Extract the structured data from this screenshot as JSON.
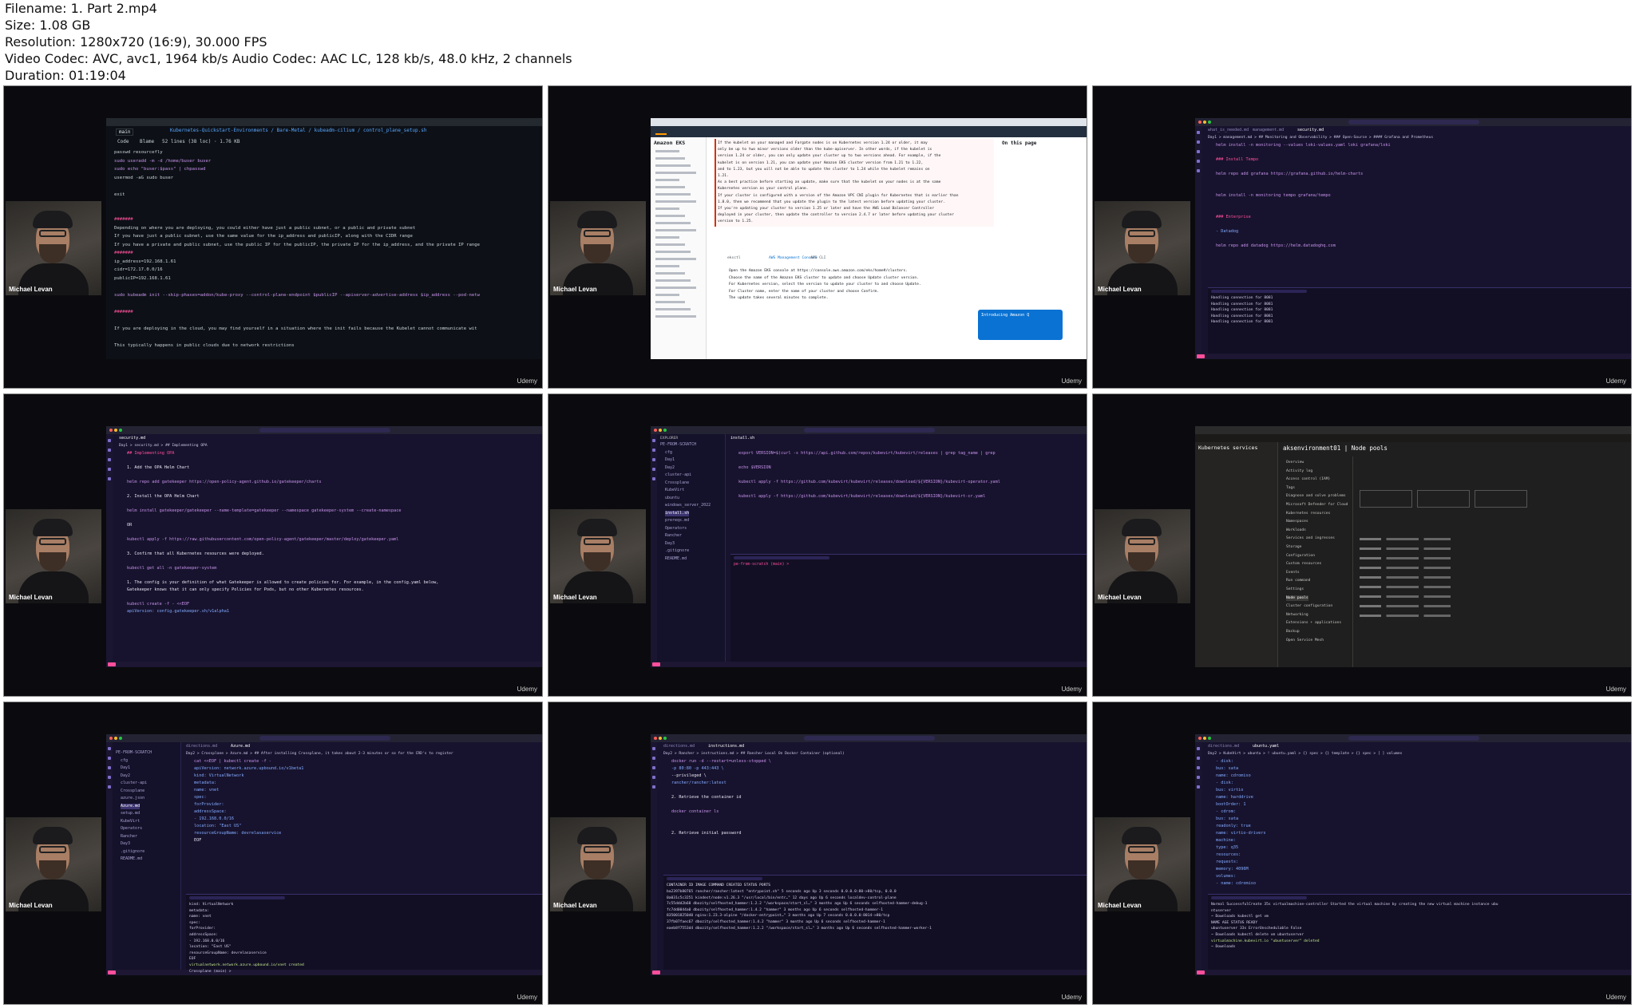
{
  "file_info": {
    "filename": "Filename: 1. Part 2.mp4",
    "size": "Size: 1.08 GB",
    "resolution": "Resolution: 1280x720 (16:9), 30.000 FPS",
    "codecs": "Video Codec: AVC, avc1, 1964 kb/s Audio Codec: AAC LC, 128 kb/s, 48.0 kHz, 2 channels",
    "duration": "Duration: 01:19:04"
  },
  "presenter": "Michael Levan",
  "watermark": "Udemy",
  "thumbnails": [
    {
      "id": "t1",
      "topic": "github-code-view",
      "breadcrumb": "Kubernetes-Quickstart-Environments / Bare-Metal / kubeadm-cilium / control_plane_setup.sh",
      "branch": "main",
      "tabs": [
        "Code",
        "Blame",
        "52 lines (38 loc) · 1.76 KB"
      ],
      "lines": [
        "  passwd resourcefly",
        "  sudo useradd -m -d /home/buser buser",
        "  sudo echo \"buser:$pass\" | chpasswd",
        "  usermod -aG sudo buser",
        "",
        "  exit",
        "",
        "",
        "  #######",
        "  Depending on where you are deploying, you could either have just a public subnet, or a public and private subnet",
        "  If you have just a public subnet, use the same value for the ip_address and publicIP, along with the CIDR range",
        "  If you have a private and public subnet, use the public IP for the publicIP, the private IP for the ip_address, and the private IP range",
        "  #######",
        "  ip_address=192.168.1.61",
        "  cidr=172.17.0.0/16",
        "  publicIP=192.168.1.61",
        "",
        "  sudo kubeadm init --skip-phases=addon/kube-proxy --control-plane-endpoint $publicIP --apiserver-advertise-address $ip_address --pod-netw",
        "",
        "  #######",
        "",
        "  If you are deploying in the cloud, you may find yourself in a situation where the init fails because the Kubelet cannot communicate wit",
        "",
        "  This typically happens in public clouds due to network restrictions"
      ]
    },
    {
      "id": "t2",
      "topic": "aws-eks-docs",
      "nav_title": "Amazon EKS",
      "right_title": "On this page",
      "lines": [
        "If the kubelet on your managed and Fargate nodes is on Kubernetes version 1.24 or older, it may",
        "only be up to two minor versions older than the kube-apiserver. In other words, if the kubelet is",
        "version 1.24 or older, you can only update your cluster up to two versions ahead. For example, if the",
        "kubelet is on version 1.21, you can update your Amazon EKS cluster version from 1.21 to 1.22,",
        "and to 1.23, but you will not be able to update the cluster to 1.24 while the kubelet remains on",
        "1.21.",
        "As a best practice before starting an update, make sure that the kubelet on your nodes is at the same",
        "Kubernetes version as your control plane.",
        "If your cluster is configured with a version of the Amazon VPC CNI plugin for Kubernetes that is earlier than",
        "1.8.0, then we recommend that you update the plugin to the latest version before updating your cluster.",
        "If you're updating your cluster to version 1.25 or later and have the AWS Load Balancer Controller",
        "deployed in your cluster, then update the controller to version 2.4.7 or later before updating your cluster",
        "version to 1.25."
      ],
      "tabs": [
        "eksctl",
        "AWS Management Console",
        "AWS CLI"
      ],
      "steps": [
        "Open the Amazon EKS console at https://console.aws.amazon.com/eks/home#/clusters.",
        "Choose the name of the Amazon EKS cluster to update and choose Update cluster version.",
        "For Kubernetes version, select the version to update your cluster to and choose Update.",
        "For Cluster name, enter the name of your cluster and choose Confirm.",
        "The update takes several minutes to complete."
      ],
      "popup_title": "Introducing Amazon Q"
    },
    {
      "id": "t3",
      "topic": "monitoring-md",
      "tabs": [
        "what_is_needed.md",
        "management.md",
        "security.md"
      ],
      "breadcrumb": "Day1 > management.md > ## Monitoring and Observability > ### Open-Source > #### Grafana and Prometheus",
      "lines": [
        "helm install -n monitoring --values loki-values.yaml loki grafana/loki",
        "",
        "### Install Tempo",
        "",
        "helm repo add grafana https://grafana.github.io/helm-charts",
        "",
        "",
        "helm install -n monitoring tempo grafana/tempo",
        "",
        "",
        "### Enterprise",
        "",
        "- Datadog",
        "",
        "helm repo add datadog https://helm.datadoghq.com"
      ],
      "terminal": [
        "Handling connection for 8081",
        "Handling connection for 8081",
        "Handling connection for 8081",
        "Handling connection for 8081",
        "Handling connection for 8081"
      ]
    },
    {
      "id": "t4",
      "topic": "security-md-opa",
      "tab": "security.md",
      "breadcrumb": "Day1 > security.md > ## Implementing OPA",
      "lines": [
        "## Implementing OPA",
        "",
        "1. Add the OPA Helm Chart",
        "",
        "helm repo add gatekeeper https://open-policy-agent.github.io/gatekeeper/charts",
        "",
        "2. Install the OPA Helm Chart",
        "",
        "helm install gatekeeper/gatekeeper --name-template=gatekeeper --namespace gatekeeper-system --create-namespace",
        "",
        "OR",
        "",
        "kubectl apply -f https://raw.githubusercontent.com/open-policy-agent/gatekeeper/master/deploy/gatekeeper.yaml",
        "",
        "3. Confirm that all Kubernetes resources were deployed.",
        "",
        "kubectl get all -n gatekeeper-system",
        "",
        "1. The config is your definition of what Gatekeeper is allowed to create policies for. For example, in the config.yaml below,",
        "Gatekeeper knows that it can only specify Policies for Pods, but no other Kubernetes resources.",
        "",
        "kubectl create -f - <<EOF",
        "apiVersion: config.gatekeeper.sh/v1alpha1"
      ]
    },
    {
      "id": "t5",
      "topic": "kubevirt-install",
      "tab": "install.sh",
      "explorer_title": "EXPLORER",
      "explorer": [
        "PE-FROM-SCRATCH",
        "cfg",
        "Day1",
        "Day2",
        "cluster-api",
        "Crossplane",
        "KubeVirt",
        "ubuntu",
        "windows_server_2022",
        "install.sh",
        "prereqs.md",
        "Operators",
        "Rancher",
        "Day3",
        ".gitignore",
        "README.md"
      ],
      "lines": [
        "export VERSION=$(curl -s https://api.github.com/repos/kubevirt/kubevirt/releases | grep tag_name | grep",
        "",
        "echo $VERSION",
        "",
        "kubectl apply -f https://github.com/kubevirt/kubevirt/releases/download/${VERSION}/kubevirt-operator.yaml",
        "",
        "kubectl apply -f https://github.com/kubevirt/kubevirt/releases/download/${VERSION}/kubevirt-cr.yaml"
      ],
      "terminal_prompt": "pe-from-scratch (main) >"
    },
    {
      "id": "t6",
      "topic": "azure-aks",
      "left_title": "Kubernetes services",
      "title": "aksenvironment01 | Node pools",
      "menu": [
        "Overview",
        "Activity log",
        "Access control (IAM)",
        "Tags",
        "Diagnose and solve problems",
        "Microsoft Defender for Cloud",
        "Kubernetes resources",
        "Namespaces",
        "Workloads",
        "Services and ingresses",
        "Storage",
        "Configuration",
        "Custom resources",
        "Events",
        "Run command",
        "Settings",
        "Node pools",
        "Cluster configuration",
        "Networking",
        "Extensions + applications",
        "Backup",
        "Open Service Mesh"
      ]
    },
    {
      "id": "t7",
      "topic": "crossplane-azure",
      "tabs": [
        "directions.md",
        "Azure.md"
      ],
      "breadcrumb": "Day2 > Crossplane > Azure.md > ## After installing Crossplane, it takes about 2-3 minutes or so for the CRD's to register",
      "explorer": [
        "PE-FROM-SCRATCH",
        "cfg",
        "Day1",
        "Day2",
        "cluster-api",
        "Crossplane",
        "azure.json",
        "Azure.md",
        "setup.md",
        "KubeVirt",
        "Operators",
        "Rancher",
        "Day3",
        ".gitignore",
        "README.md"
      ],
      "lines": [
        "cat <<EOF | kubectl create -f -",
        "apiVersion: network.azure.upbound.io/v1beta1",
        "kind: VirtualNetwork",
        "metadata:",
        "  name: vnet",
        "spec:",
        "  forProvider:",
        "    addressSpace:",
        "      - 192.168.0.0/16",
        "    location: \"East US\"",
        "    resourceGroupName: devrelasaservice",
        "EOF"
      ],
      "terminal": [
        "kind: VirtualNetwork",
        "metadata:",
        "  name: vnet",
        "spec:",
        "  forProvider:",
        "    addressSpace:",
        "      - 192.168.0.0/16",
        "    location: \"East US\"",
        "    resourceGroupName: devrelasaservice",
        "EOF",
        "virtualnetwork.network.azure.upbound.io/vnet created",
        "Crossplane (main) >"
      ]
    },
    {
      "id": "t8",
      "topic": "rancher-docker",
      "tabs": [
        "directions.md",
        "instructions.md"
      ],
      "breadcrumb": "Day2 > Rancher > instructions.md > ## Rancher Local On Docker Container (optional)",
      "lines": [
        "docker run -d --restart=unless-stopped \\",
        "  -p 80:80 -p 443:443 \\",
        "  --privileged \\",
        "  rancher/rancher:latest",
        "",
        "2. Retrieve the container id",
        "",
        "docker container ls",
        "",
        "",
        "2. Retrieve initial password"
      ],
      "terminal_header": "CONTAINER ID   IMAGE                              COMMAND                  CREATED          STATUS         PORTS",
      "terminal": [
        "ba2397b80765   rancher/rancher:latest             \"entrypoint.sh\"          5 seconds ago    Up 3 seconds   0.0.0.0:80->80/tcp, 0.0.0",
        "0a031c5c3251   kindest/node:v1.26.3               \"/usr/local/bin/entr…\"   12 days ago      Up 6 seconds   localdev-control-plane",
        "7c55ddd2b68   dbozity/selfhosted_hammer:1.2.2     \"/workspace/start_sl…\"   3 months ago     Up 6 seconds   selfhosted-hammer-debug-1",
        "fc7dd0044a0   dbozity/selfhosted_hammer:1.4.2     \"hammer\"                 3 months ago     Up 6 seconds   selfhosted-hammer-1",
        "835001825040  nginx:1.23.3-alpine                 \"/docker-entrypoint…\"    3 months ago     Up 7 seconds   0.0.0.0:8014->80/tcp",
        "37fb07faec67  dbozity/selfhosted_hammer:1.4.2     \"hammer\"                 3 months ago     Up 6 seconds   selfhosted-hammer-1",
        "eaeb8f7553d4  dbozity/selfhosted_hammer:1.2.2     \"/workspace/start_sl…\"   3 months ago     Up 6 seconds   selfhosted-hammer-worker-1"
      ]
    },
    {
      "id": "t9",
      "topic": "kubevirt-ubuntu-yaml",
      "tabs": [
        "directions.md",
        "ubuntu.yaml"
      ],
      "breadcrumb": "Day2 > KubeVirt > ubuntu > ! ubuntu.yaml > {} spec > {} template > {} spec > [ ] volumes",
      "lines": [
        "      - disk:",
        "          bus: sata",
        "        name: cdromiso",
        "      - disk:",
        "          bus: virtio",
        "        name: harddrive",
        "        bootOrder: 1",
        "      - cdrom:",
        "          bus: sata",
        "          readonly: true",
        "        name: virtio-drivers",
        "      machine:",
        "        type: q35",
        "      resources:",
        "        requests:",
        "          memory: 4096M",
        "      volumes:",
        "      - name: cdromiso",
        "        persistentVolumeClaim:",
        "          claimName: ubuntuiso"
      ],
      "terminal": [
        "  Normal  SuccessfulCreate  35s  virtualmachine-controller  Started the virtual machine by creating the new virtual machine instance ubu",
        "ntuserver",
        "~ Downloads  kubectl get vm",
        "NAME           AGE   STATUS                 READY",
        "ubuntuserver   33s   ErrorUnschedulable     False",
        "~ Downloads  kubectl delete vm ubuntuserver",
        "virtualmachine.kubevirt.io \"ubuntuserver\" deleted",
        "~ Downloads"
      ]
    }
  ],
  "colors": {
    "editor_bg": "#17132e",
    "purple_accent": "#c792ea",
    "pink_accent": "#ff4f9a",
    "string_green": "#c3e88d",
    "link_blue": "#82aaff",
    "gh_bg": "#0d1117",
    "aws_orange": "#ff9900",
    "azure_dark": "#1b1a19"
  }
}
